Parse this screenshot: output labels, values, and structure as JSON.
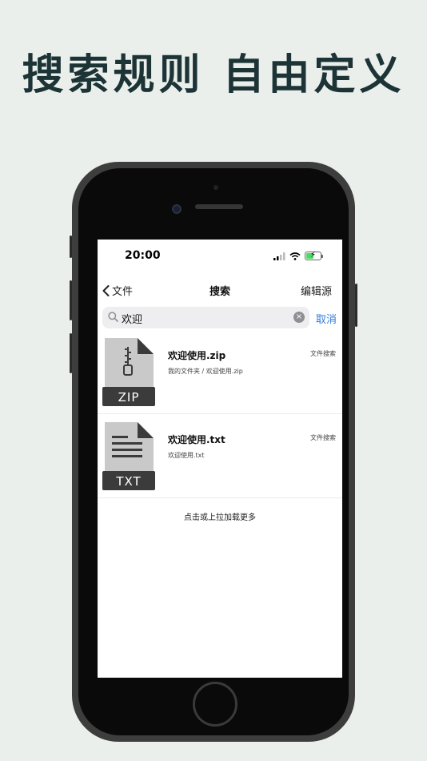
{
  "headline": "搜索规则 自由定义",
  "status_bar": {
    "time": "20:00"
  },
  "nav": {
    "back_label": "文件",
    "title": "搜索",
    "right_label": "编辑源"
  },
  "search": {
    "query": "欢迎",
    "cancel_label": "取消",
    "clear_symbol": "×"
  },
  "results": [
    {
      "icon_label": "ZIP",
      "name": "欢迎使用.zip",
      "path": "我的文件夹 / 欢迎使用.zip",
      "tag": "文件搜索"
    },
    {
      "icon_label": "TXT",
      "name": "欢迎使用.txt",
      "path": "欢迎使用.txt",
      "tag": "文件搜索"
    }
  ],
  "load_more": "点击或上拉加载更多",
  "colors": {
    "headline": "#1d3437",
    "accent": "#2f7bdc",
    "background": "#eaefec",
    "file_icon": "#3b3b3b"
  }
}
